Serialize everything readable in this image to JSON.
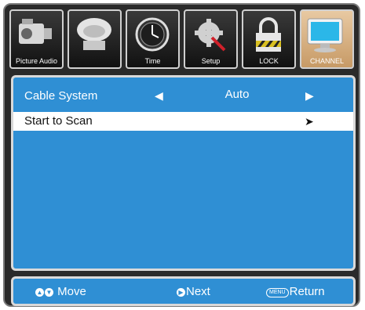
{
  "tabs": [
    {
      "label": "Picture Audio",
      "icon": "camcorder-icon"
    },
    {
      "label": "",
      "icon": "speaker-icon"
    },
    {
      "label": "Time",
      "icon": "clock-icon"
    },
    {
      "label": "Setup",
      "icon": "gear-icon"
    },
    {
      "label": "LOCK",
      "icon": "lock-icon"
    },
    {
      "label": "CHANNEL",
      "icon": "monitor-icon",
      "active": true
    }
  ],
  "menu": {
    "cable_system": {
      "label": "Cable System",
      "value": "Auto"
    },
    "start_scan": {
      "label": "Start to Scan"
    }
  },
  "footer": {
    "move": "Move",
    "next": "Next",
    "return": "Return",
    "menu_key": "MENU"
  },
  "colors": {
    "panel_blue": "#2f8fd4",
    "frame_dark": "#2a2a2a",
    "highlight_row": "#ffffff",
    "active_tab": "#d9b488"
  }
}
